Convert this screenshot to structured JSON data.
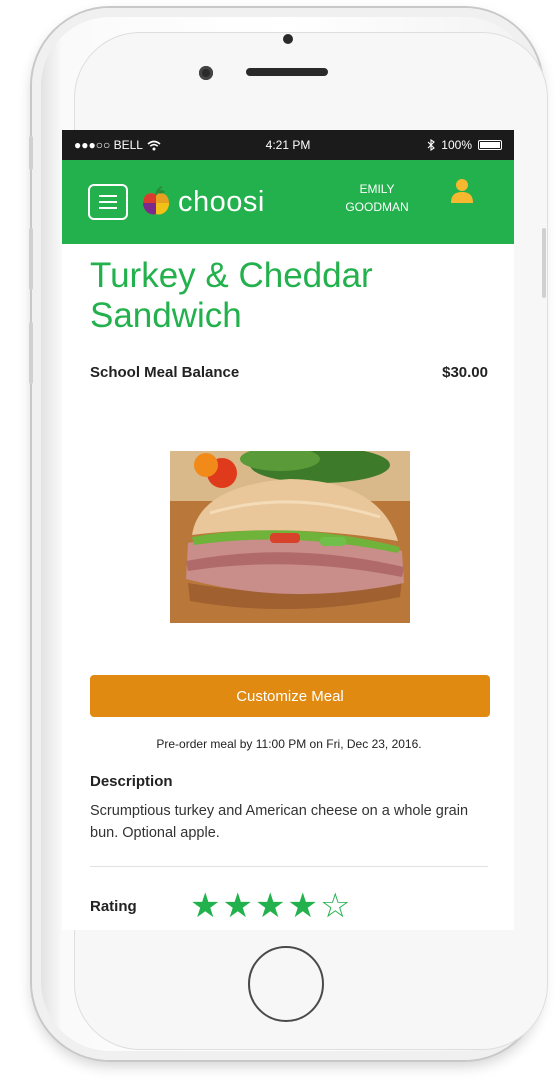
{
  "status_bar": {
    "carrier": "●●●○○ BELL",
    "time": "4:21 PM",
    "battery": "100%"
  },
  "header": {
    "logo_text": "choosi",
    "user_first": "EMILY",
    "user_last": "GOODMAN"
  },
  "meal": {
    "title_line1": "Turkey & Cheddar",
    "title_line2": "Sandwich",
    "balance_label": "School Meal Balance",
    "balance_value": "$30.00",
    "customize_label": "Customize Meal",
    "preorder_text": "Pre-order meal by 11:00 PM on Fri, Dec 23, 2016.",
    "description_label": "Description",
    "description_text": "Scrumptious turkey and American cheese on a whole grain bun.  Optional apple.",
    "rating_label": "Rating",
    "rating_value": 4,
    "rating_max": 5
  },
  "colors": {
    "brand_green": "#22b14c",
    "button_orange": "#e08a12"
  }
}
